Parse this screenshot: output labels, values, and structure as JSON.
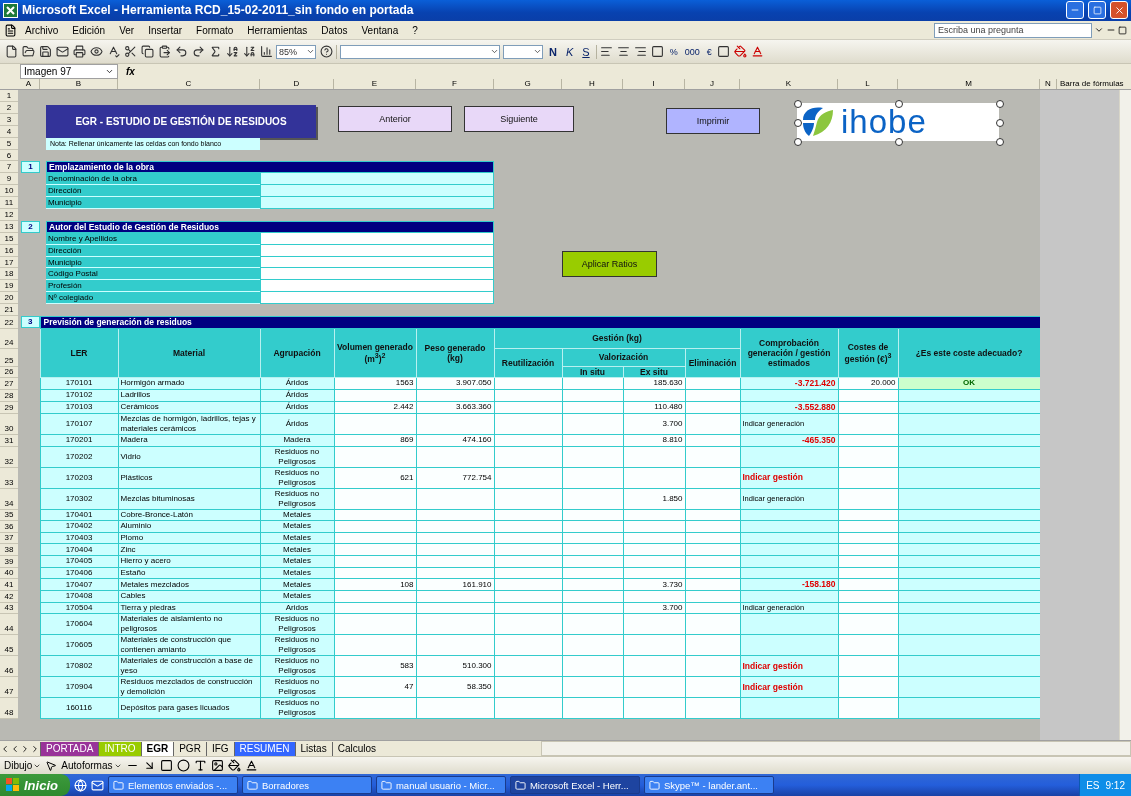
{
  "window": {
    "title": "Microsoft Excel - Herramienta RCD_15-02-2011_sin fondo en portada"
  },
  "menu": [
    "Archivo",
    "Edición",
    "Ver",
    "Insertar",
    "Formato",
    "Herramientas",
    "Datos",
    "Ventana",
    "?"
  ],
  "help_search": {
    "placeholder": "Escriba una pregunta"
  },
  "toolbar": {
    "zoom": "85%",
    "format_buttons": [
      "N",
      "K",
      "S"
    ],
    "number_format_buttons": [
      "%",
      "000",
      "€"
    ]
  },
  "formula_bar": {
    "name_box": "Imagen 97",
    "fx_label": "fx"
  },
  "columns": [
    "A",
    "B",
    "C",
    "D",
    "E",
    "F",
    "G",
    "H",
    "I",
    "J",
    "K",
    "L",
    "M",
    "N"
  ],
  "task_pane": {
    "title": "Barra de fórmulas"
  },
  "sheet": {
    "title": "EGR - ESTUDIO DE GESTIÓN DE RESIDUOS",
    "note": "Nota: Rellenar únicamente las celdas con fondo blanco",
    "top_rows": [
      "1",
      "2",
      "3",
      "4",
      "5",
      "6",
      "7",
      "9",
      "10",
      "11",
      "12",
      "13",
      "15",
      "16",
      "17",
      "18",
      "19",
      "20",
      "21"
    ],
    "buttons": [
      "Anterior",
      "Siguiente",
      "Imprimir",
      "Aplicar Ratios"
    ],
    "logo_text": "ihobe",
    "sections": [
      {
        "number": "1",
        "title": "Emplazamiento de la obra",
        "fields": [
          "Denominación de la obra",
          "Dirección",
          "Municipio"
        ]
      },
      {
        "number": "2",
        "title": "Autor del Estudio de Gestión de Residuos",
        "fields": [
          "Nombre y Apellidos",
          "Dirección",
          "Municipio",
          "Código Postal",
          "Profesión",
          "Nº colegiado"
        ]
      }
    ],
    "table_section": {
      "row": "22",
      "number": "3",
      "title": "Previsión de generación de residuos"
    },
    "table": {
      "header_rows": [
        "24",
        "25",
        "26"
      ],
      "headers": {
        "ler": "LER",
        "material": "Material",
        "group": "Agrupación",
        "volume": "Volumen generado (m$^{3}$)$^{2}$",
        "weight": "Peso generado (kg)",
        "management": "Gestión (kg)",
        "reuse": "Reutilización",
        "recovery": "Valorización",
        "in_situ": "In situ",
        "ex_situ": "Ex situ",
        "elimination": "Eliminación",
        "check": "Comprobación generación / gestión estimados",
        "cost": "Costes de gestión (€)$^{3}$",
        "adequate": "¿Es este coste adecuado?"
      },
      "rows": [
        {
          "row": "27",
          "ler": "170101",
          "material": "Hormigón armado",
          "group": "Áridos",
          "volume": "1563",
          "weight": "3.907.050",
          "ex_situ": "185.630",
          "check": {
            "text": "-3.721.420",
            "kind": "alert"
          },
          "cost": "20.000",
          "adequate": {
            "text": "OK",
            "kind": "ok"
          }
        },
        {
          "row": "28",
          "ler": "170102",
          "material": "Ladrillos",
          "group": "Áridos"
        },
        {
          "row": "29",
          "ler": "170103",
          "material": "Cerámicos",
          "group": "Áridos",
          "volume": "2.442",
          "weight": "3.663.360",
          "ex_situ": "110.480",
          "check": {
            "text": "-3.552.880",
            "kind": "alert"
          }
        },
        {
          "row": "30",
          "ler": "170107",
          "material": "Mezclas de hormigón, ladrillos, tejas y materiales cerámicos",
          "group": "Áridos",
          "ex_situ": "3.700",
          "check": {
            "text": "Indicar generación",
            "kind": "info"
          }
        },
        {
          "row": "31",
          "ler": "170201",
          "material": "Madera",
          "group": "Madera",
          "volume": "869",
          "weight": "474.160",
          "ex_situ": "8.810",
          "check": {
            "text": "-465.350",
            "kind": "alert"
          }
        },
        {
          "row": "32",
          "ler": "170202",
          "material": "Vidrio",
          "group": "Residuos no Peligrosos"
        },
        {
          "row": "33",
          "ler": "170203",
          "material": "Plásticos",
          "group": "Residuos no Peligrosos",
          "volume": "621",
          "weight": "772.754",
          "check": {
            "text": "Indicar gestión",
            "kind": "alert"
          }
        },
        {
          "row": "34",
          "ler": "170302",
          "material": "Mezclas bituminosas",
          "group": "Residuos no Peligrosos",
          "ex_situ": "1.850",
          "check": {
            "text": "Indicar generación",
            "kind": "info"
          }
        },
        {
          "row": "35",
          "ler": "170401",
          "material": "Cobre-Bronce-Latón",
          "group": "Metales"
        },
        {
          "row": "36",
          "ler": "170402",
          "material": "Aluminio",
          "group": "Metales"
        },
        {
          "row": "37",
          "ler": "170403",
          "material": "Plomo",
          "group": "Metales"
        },
        {
          "row": "38",
          "ler": "170404",
          "material": "Zinc",
          "group": "Metales"
        },
        {
          "row": "39",
          "ler": "170405",
          "material": "Hierro y acero",
          "group": "Metales"
        },
        {
          "row": "40",
          "ler": "170406",
          "material": "Estaño",
          "group": "Metales"
        },
        {
          "row": "41",
          "ler": "170407",
          "material": "Metales mezclados",
          "group": "Metales",
          "volume": "108",
          "weight": "161.910",
          "ex_situ": "3.730",
          "check": {
            "text": "-158.180",
            "kind": "alert"
          }
        },
        {
          "row": "42",
          "ler": "170408",
          "material": "Cables",
          "group": "Metales"
        },
        {
          "row": "43",
          "ler": "170504",
          "material": "Tierra y piedras",
          "group": "Aridos",
          "ex_situ": "3.700",
          "check": {
            "text": "Indicar generación",
            "kind": "info"
          }
        },
        {
          "row": "44",
          "ler": "170604",
          "material": "Materiales de aislamiento no peligrosos",
          "group": "Residuos no Peligrosos"
        },
        {
          "row": "45",
          "ler": "170605",
          "material": "Materiales de construcción que contienen amianto",
          "group": "Residuos no Peligrosos"
        },
        {
          "row": "46",
          "ler": "170802",
          "material": "Materiales de construcción a base de yeso",
          "group": "Residuos no Peligrosos",
          "volume": "583",
          "weight": "510.300",
          "check": {
            "text": "Indicar gestión",
            "kind": "alert"
          }
        },
        {
          "row": "47",
          "ler": "170904",
          "material": "Residuos mezclados de construcción y demolición",
          "group": "Residuos no Peligrosos",
          "volume": "47",
          "weight": "58.350",
          "check": {
            "text": "Indicar gestión",
            "kind": "alert"
          }
        },
        {
          "row": "48",
          "ler": "160116",
          "material": "Depósitos para gases licuados",
          "group": "Residuos no Peligrosos"
        }
      ]
    }
  },
  "sheet_tabs": [
    {
      "label": "PORTADA",
      "selected": false,
      "color": "#993399"
    },
    {
      "label": "INTRO",
      "selected": false,
      "color": "#99cc00"
    },
    {
      "label": "EGR",
      "selected": true
    },
    {
      "label": "PGR",
      "selected": false
    },
    {
      "label": "IFG",
      "selected": false
    },
    {
      "label": "RESUMEN",
      "selected": false,
      "color": "#3366ff"
    },
    {
      "label": "Listas",
      "selected": false
    },
    {
      "label": "Calculos",
      "selected": false
    }
  ],
  "drawing_toolbar": {
    "draw_menu": "Dibujo",
    "autoshapes_menu": "Autoformas"
  },
  "taskbar": {
    "start": "Inicio",
    "tasks": [
      {
        "label": "Elementos enviados -...",
        "selected": false
      },
      {
        "label": "Borradores",
        "selected": false
      },
      {
        "label": "manual usuario - Micr...",
        "selected": false
      },
      {
        "label": "Microsoft Excel - Herr...",
        "selected": true
      },
      {
        "label": "Skype™ - lander.ant...",
        "selected": false
      }
    ],
    "language": "ES",
    "clock": "9:12"
  }
}
